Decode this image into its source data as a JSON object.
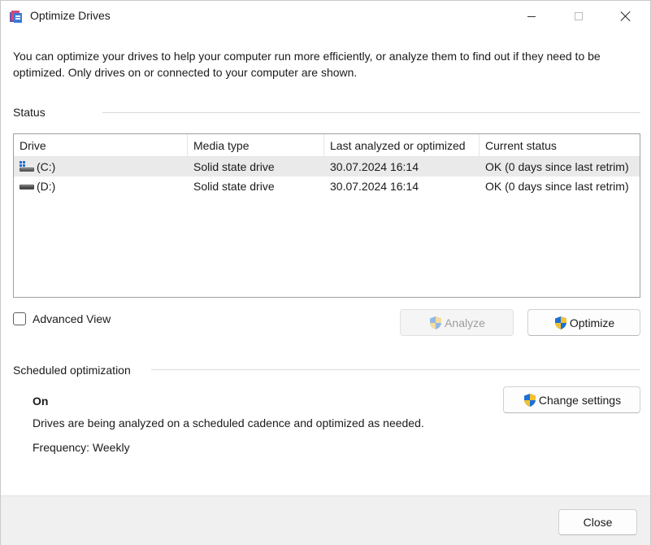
{
  "window": {
    "title": "Optimize Drives",
    "icon": "defrag-app-icon"
  },
  "intro": "You can optimize your drives to help your computer run more efficiently, or analyze them to find out if they need to be optimized. Only drives on or connected to your computer are shown.",
  "status": {
    "section_title": "Status",
    "columns": [
      "Drive",
      "Media type",
      "Last analyzed or optimized",
      "Current status"
    ],
    "rows": [
      {
        "drive": "(C:)",
        "media_type": "Solid state drive",
        "last": "30.07.2024 16:14",
        "status": "OK (0 days since last retrim)",
        "icon": "system-drive-icon",
        "selected": true
      },
      {
        "drive": "(D:)",
        "media_type": "Solid state drive",
        "last": "30.07.2024 16:14",
        "status": "OK (0 days since last retrim)",
        "icon": "drive-icon",
        "selected": false
      }
    ]
  },
  "advanced_view": {
    "label": "Advanced View",
    "checked": false
  },
  "buttons": {
    "analyze": "Analyze",
    "optimize": "Optimize",
    "change_settings": "Change settings",
    "close": "Close"
  },
  "scheduled": {
    "section_title": "Scheduled optimization",
    "state": "On",
    "description": "Drives are being analyzed on a scheduled cadence and optimized as needed.",
    "frequency": "Frequency: Weekly"
  },
  "colors": {
    "shield_blue": "#1f6fd6",
    "shield_yellow": "#f2c230",
    "selected_row": "#eaeaea",
    "footer": "#f0f0f0"
  }
}
